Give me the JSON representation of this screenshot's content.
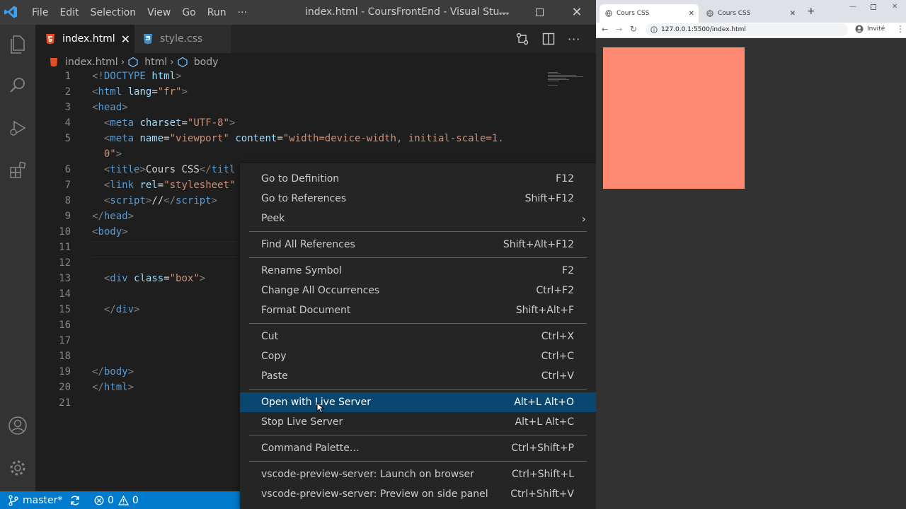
{
  "titlebar": {
    "menu": [
      "File",
      "Edit",
      "Selection",
      "View",
      "Go",
      "Run",
      "···"
    ],
    "title": "index.html - CoursFrontEnd - Visual Stu..."
  },
  "tabs": [
    {
      "label": "index.html",
      "active": true
    },
    {
      "label": "style.css",
      "active": false
    }
  ],
  "breadcrumb": {
    "file": "index.html",
    "path": [
      "html",
      "body"
    ]
  },
  "code": [
    {
      "n": "1",
      "tokens": [
        [
          "br",
          "<!"
        ],
        [
          "tag",
          "DOCTYPE"
        ],
        [
          "txt",
          " "
        ],
        [
          "at",
          "html"
        ],
        [
          "br",
          ">"
        ]
      ]
    },
    {
      "n": "2",
      "tokens": [
        [
          "br",
          "<"
        ],
        [
          "tag",
          "html"
        ],
        [
          "txt",
          " "
        ],
        [
          "at",
          "lang"
        ],
        [
          "txt",
          "="
        ],
        [
          "str",
          "\"fr\""
        ],
        [
          "br",
          ">"
        ]
      ]
    },
    {
      "n": "3",
      "tokens": [
        [
          "br",
          "<"
        ],
        [
          "tag",
          "head"
        ],
        [
          "br",
          ">"
        ]
      ]
    },
    {
      "n": "4",
      "tokens": [
        [
          "txt",
          "  "
        ],
        [
          "br",
          "<"
        ],
        [
          "tag",
          "meta"
        ],
        [
          "txt",
          " "
        ],
        [
          "at",
          "charset"
        ],
        [
          "txt",
          "="
        ],
        [
          "str",
          "\"UTF-8\""
        ],
        [
          "br",
          ">"
        ]
      ]
    },
    {
      "n": "5",
      "tokens": [
        [
          "txt",
          "  "
        ],
        [
          "br",
          "<"
        ],
        [
          "tag",
          "meta"
        ],
        [
          "txt",
          " "
        ],
        [
          "at",
          "name"
        ],
        [
          "txt",
          "="
        ],
        [
          "str",
          "\"viewport\""
        ],
        [
          "txt",
          " "
        ],
        [
          "at",
          "content"
        ],
        [
          "txt",
          "="
        ],
        [
          "str",
          "\"width=device-width, initial-scale=1."
        ]
      ]
    },
    {
      "n": "",
      "tokens": [
        [
          "str",
          "  0\""
        ],
        [
          "br",
          ">"
        ]
      ]
    },
    {
      "n": "6",
      "tokens": [
        [
          "txt",
          "  "
        ],
        [
          "br",
          "<"
        ],
        [
          "tag",
          "title"
        ],
        [
          "br",
          ">"
        ],
        [
          "txt",
          "Cours CSS"
        ],
        [
          "br",
          "</"
        ],
        [
          "tag",
          "titl"
        ]
      ]
    },
    {
      "n": "7",
      "tokens": [
        [
          "txt",
          "  "
        ],
        [
          "br",
          "<"
        ],
        [
          "tag",
          "link"
        ],
        [
          "txt",
          " "
        ],
        [
          "at",
          "rel"
        ],
        [
          "txt",
          "="
        ],
        [
          "str",
          "\"stylesheet\""
        ]
      ]
    },
    {
      "n": "8",
      "tokens": [
        [
          "txt",
          "  "
        ],
        [
          "br",
          "<"
        ],
        [
          "tag",
          "script"
        ],
        [
          "br",
          ">"
        ],
        [
          "txt",
          "//"
        ],
        [
          "br",
          "</"
        ],
        [
          "tag",
          "script"
        ],
        [
          "br",
          ">"
        ]
      ]
    },
    {
      "n": "9",
      "tokens": [
        [
          "br",
          "</"
        ],
        [
          "tag",
          "head"
        ],
        [
          "br",
          ">"
        ]
      ]
    },
    {
      "n": "10",
      "tokens": [
        [
          "br",
          "<"
        ],
        [
          "tag",
          "body"
        ],
        [
          "br",
          ">"
        ]
      ]
    },
    {
      "n": "11",
      "tokens": []
    },
    {
      "n": "12",
      "tokens": []
    },
    {
      "n": "13",
      "tokens": [
        [
          "txt",
          "  "
        ],
        [
          "br",
          "<"
        ],
        [
          "tag",
          "div"
        ],
        [
          "txt",
          " "
        ],
        [
          "at",
          "class"
        ],
        [
          "txt",
          "="
        ],
        [
          "str",
          "\"box\""
        ],
        [
          "br",
          ">"
        ]
      ]
    },
    {
      "n": "14",
      "tokens": []
    },
    {
      "n": "15",
      "tokens": [
        [
          "txt",
          "  "
        ],
        [
          "br",
          "</"
        ],
        [
          "tag",
          "div"
        ],
        [
          "br",
          ">"
        ]
      ]
    },
    {
      "n": "16",
      "tokens": []
    },
    {
      "n": "17",
      "tokens": []
    },
    {
      "n": "18",
      "tokens": []
    },
    {
      "n": "19",
      "tokens": [
        [
          "br",
          "</"
        ],
        [
          "tag",
          "body"
        ],
        [
          "br",
          ">"
        ]
      ]
    },
    {
      "n": "20",
      "tokens": [
        [
          "br",
          "</"
        ],
        [
          "tag",
          "html"
        ],
        [
          "br",
          ">"
        ]
      ]
    },
    {
      "n": "21",
      "tokens": []
    }
  ],
  "context_menu": [
    {
      "label": "Go to Definition",
      "key": "F12"
    },
    {
      "label": "Go to References",
      "key": "Shift+F12"
    },
    {
      "label": "Peek",
      "key": "",
      "submenu": true
    },
    {
      "sep": true
    },
    {
      "label": "Find All References",
      "key": "Shift+Alt+F12"
    },
    {
      "sep": true
    },
    {
      "label": "Rename Symbol",
      "key": "F2"
    },
    {
      "label": "Change All Occurrences",
      "key": "Ctrl+F2"
    },
    {
      "label": "Format Document",
      "key": "Shift+Alt+F"
    },
    {
      "sep": true
    },
    {
      "label": "Cut",
      "key": "Ctrl+X"
    },
    {
      "label": "Copy",
      "key": "Ctrl+C"
    },
    {
      "label": "Paste",
      "key": "Ctrl+V"
    },
    {
      "sep": true
    },
    {
      "label": "Open with Live Server",
      "key": "Alt+L Alt+O",
      "selected": true
    },
    {
      "label": "Stop Live Server",
      "key": "Alt+L Alt+C"
    },
    {
      "sep": true
    },
    {
      "label": "Command Palette...",
      "key": "Ctrl+Shift+P"
    },
    {
      "sep": true
    },
    {
      "label": "vscode-preview-server: Launch on browser",
      "key": "Ctrl+Shift+L"
    },
    {
      "label": "vscode-preview-server: Preview on side panel",
      "key": "Ctrl+Shift+V"
    }
  ],
  "statusbar": {
    "branch": "master*",
    "errors": "0",
    "warnings": "0"
  },
  "browser": {
    "tabs": [
      "Cours CSS",
      "Cours CSS"
    ],
    "url": "127.0.0.1:5500/index.html",
    "profile": "Invité",
    "box_color": "#fd8a71"
  },
  "colors": {
    "accent": "#007acc",
    "selection": "#094771"
  }
}
